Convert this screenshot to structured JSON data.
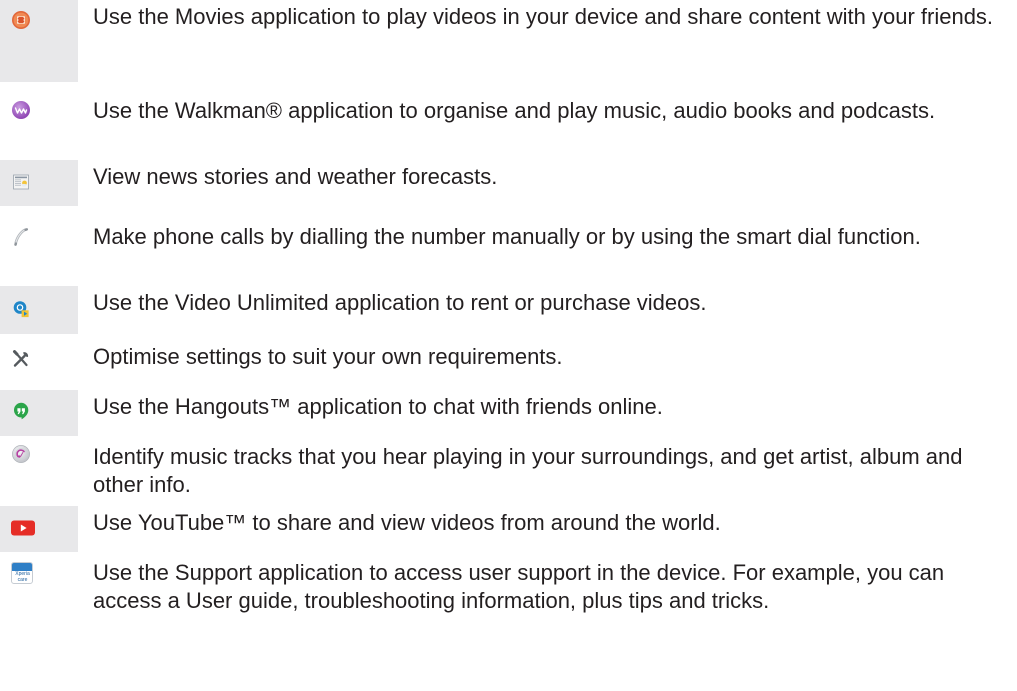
{
  "apps": [
    {
      "icon": "movies-film-icon",
      "text": "Use the Movies application to play videos in your device and share content with your friends."
    },
    {
      "icon": "walkman-icon",
      "text": "Use the Walkman® application to organise and play music, audio books and podcasts."
    },
    {
      "icon": "news-weather-icon",
      "text": "View news stories and weather forecasts."
    },
    {
      "icon": "phone-handset-icon",
      "text": "Make phone calls by dialling the number manually or by using the smart dial function."
    },
    {
      "icon": "video-unlimited-icon",
      "text": "Use the Video Unlimited application to rent or purchase videos."
    },
    {
      "icon": "settings-tools-icon",
      "text": "Optimise settings to suit your own requirements."
    },
    {
      "icon": "hangouts-icon",
      "text": "Use the Hangouts™ application to chat with friends online."
    },
    {
      "icon": "trackid-icon",
      "text": "Identify music tracks that you hear playing in your surroundings, and get artist, album and other info."
    },
    {
      "icon": "youtube-icon",
      "text": "Use YouTube™ to share and view videos from around the world."
    },
    {
      "icon": "xperia-care-icon",
      "icon_text": "Xperia care",
      "text": "Use the Support application to access user support in the device. For example, you can access a User guide, troubleshooting information, plus tips and tricks."
    }
  ]
}
